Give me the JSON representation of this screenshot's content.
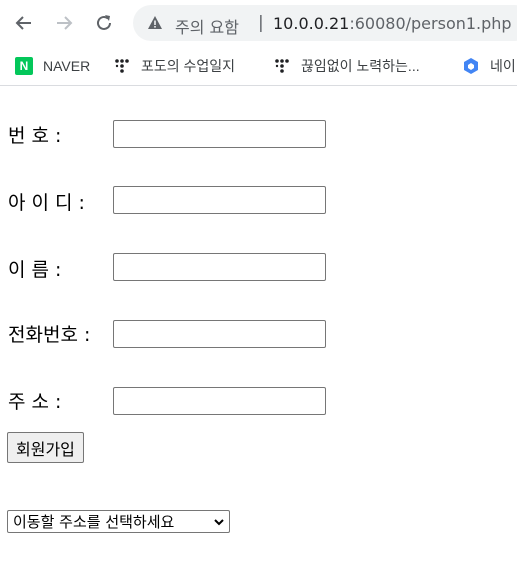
{
  "browser": {
    "security_label": "주의 요함",
    "separator": "|",
    "url_host": "10.0.0.21",
    "url_rest": ":60080/person1.php"
  },
  "bookmarks": [
    {
      "label": "NAVER",
      "icon": "naver-icon"
    },
    {
      "label": "포도의 수업일지",
      "icon": "dots-icon"
    },
    {
      "label": "끊임없이 노력하는...",
      "icon": "dots-icon"
    },
    {
      "label": "네이",
      "icon": "cube-icon"
    }
  ],
  "form": {
    "fields": [
      {
        "label": "번 호 :",
        "value": ""
      },
      {
        "label": "아 이 디 :",
        "value": ""
      },
      {
        "label": "이 름 :",
        "value": ""
      },
      {
        "label": "전화번호 :",
        "value": ""
      },
      {
        "label": "주 소 :",
        "value": ""
      }
    ],
    "submit_label": "회원가입",
    "address_select": {
      "selected": "이동할 주소를 선택하세요"
    }
  },
  "colors": {
    "naver_green": "#03c75a",
    "cube_blue": "#4285f4"
  }
}
